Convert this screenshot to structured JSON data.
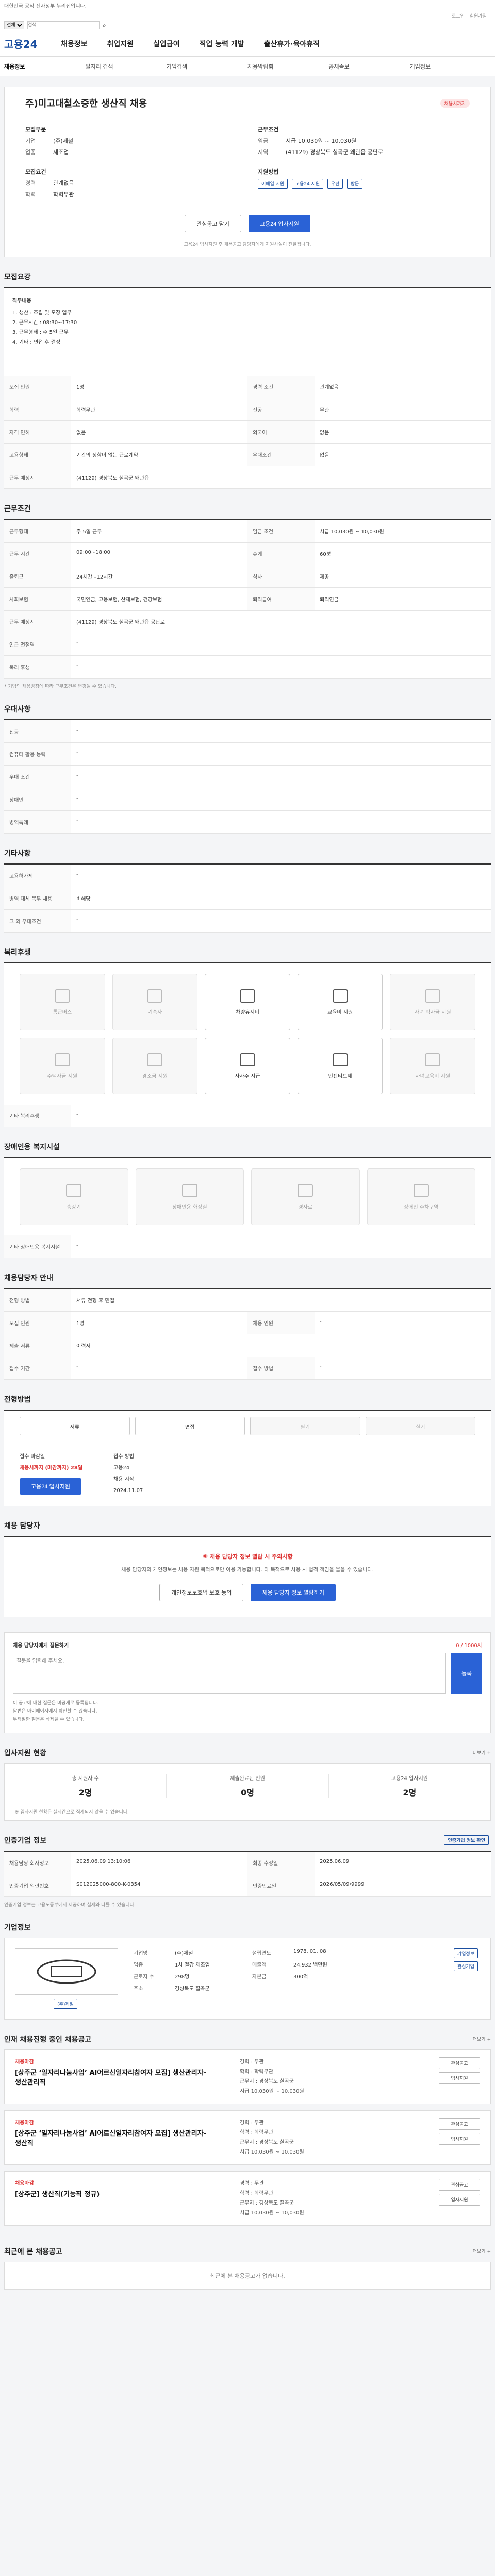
{
  "topbar": {
    "notice": "대한민국 공식 전자정부 누리집입니다."
  },
  "utility": {
    "links": [
      "로그인",
      "회원가입"
    ]
  },
  "search": {
    "select": "전체",
    "placeholder": "검색"
  },
  "header": {
    "logo": "고용24",
    "gnb": [
      "채용정보",
      "취업지원",
      "실업급여",
      "직업 능력 개발",
      "출산휴가·육아휴직"
    ]
  },
  "subnav": [
    "채용정보",
    "일자리 검색",
    "기업검색",
    "채용박람회",
    "공채속보",
    "기업정보"
  ],
  "job": {
    "title": "주)미고대철소중한 생산직 채용",
    "deadline_badge": "채용시까지",
    "company_label": "모집부문",
    "company_k1": "기업",
    "company_v1": "(주)제철",
    "company_k2": "업종",
    "company_v2": "제조업",
    "work_label": "모집요건",
    "work_k1": "경력",
    "work_v1": "관계없음",
    "work_k2": "학력",
    "work_v2": "학력무관",
    "loc_label": "근무조건",
    "loc_k1": "임금",
    "loc_v1": "시급 10,030원 ~ 10,030원",
    "loc_k2": "지역",
    "loc_v2": "(41129) 경상북도 칠곡군 왜관읍 공단로",
    "apply_label": "지원방법",
    "apply_tags": [
      "이메일 지원",
      "고용24 지원",
      "우편",
      "방문"
    ],
    "btn_interest": "관심공고 담기",
    "btn_apply": "고용24 입사지원",
    "btn_note": "고용24 입사지원 후 채용공고 담당자에게 지원사실이 전달됩니다."
  },
  "duty": {
    "header": "모집요강",
    "title": "직무내용",
    "lines": [
      "1. 생산 : 조립 및 포장 업무",
      "2. 근무시간 : 08:30~17:30",
      "3. 근무형태 : 주 5일 근무",
      "4. 기타 : 면접 후 결정"
    ]
  },
  "recruit_table": {
    "rows": [
      [
        "모집 인원",
        "1명",
        "경력 조건",
        "관계없음"
      ],
      [
        "학력",
        "학력무관",
        "전공",
        "무관"
      ],
      [
        "자격 면허",
        "없음",
        "외국어",
        "없음"
      ],
      [
        "고용형태",
        "기간의 정함이 없는 근로계약",
        "우대조건",
        "없음"
      ],
      [
        "근무 예정지",
        "(41129) 경상북도 칠곡군 왜관읍",
        "",
        ""
      ]
    ]
  },
  "cond": {
    "header": "근무조건",
    "rows": [
      [
        "근무형태",
        "주 5일 근무",
        "임금 조건",
        "시급 10,030원 ~ 10,030원"
      ],
      [
        "근무 시간",
        "09:00~18:00",
        "휴게",
        "60분"
      ],
      [
        "출퇴근",
        "24시간~12시간",
        "식사",
        "제공"
      ],
      [
        "사회보험",
        "국민연금, 고용보험, 산재보험, 건강보험",
        "퇴직급여",
        "퇴직연금"
      ],
      [
        "근무 예정지",
        "(41129) 경상북도 칠곡군 왜관읍 공단로",
        "",
        ""
      ],
      [
        "인근 전철역",
        "-",
        "",
        ""
      ],
      [
        "복리 후생",
        "-",
        "",
        ""
      ]
    ]
  },
  "cond_note": "* 기업의 채용방침에 따라 근무조건은 변경될 수 있습니다.",
  "pref": {
    "header": "우대사항",
    "rows": [
      [
        "전공",
        "-"
      ],
      [
        "컴퓨터 활용 능력",
        "-"
      ],
      [
        "우대 조건",
        "-"
      ],
      [
        "장애인",
        "-"
      ],
      [
        "병역특례",
        "-"
      ]
    ]
  },
  "etc": {
    "header": "기타사항",
    "rows": [
      [
        "고용허가제",
        "-"
      ],
      [
        "병역 대체 복무 채용",
        "비해당"
      ],
      [
        "그 외 우대조건",
        "-"
      ]
    ]
  },
  "welfare": {
    "header": "복리후생",
    "items": [
      "통근버스",
      "기숙사",
      "차량유지비",
      "교육비 지원",
      "자녀 학자금 지원",
      "주택자금 지원",
      "경조금 지원",
      "자사주 지급",
      "인센티브제",
      "자녀교육비 지원"
    ],
    "active": [
      2,
      3,
      7,
      8
    ],
    "note": "기타 복리후생"
  },
  "disabled": {
    "header": "장애인용 복지시설",
    "items": [
      "승강기",
      "장애인용 화장실",
      "경사로",
      "장애인 주차구역"
    ],
    "note": "기타 장애인용 복지시설"
  },
  "hr": {
    "header": "채용담당자 안내",
    "rows": [
      [
        "전형 방법",
        "서류 전형 후 면접",
        "",
        ""
      ],
      [
        "모집 인원",
        "1명",
        "채용 인원",
        "-"
      ],
      [
        "제출 서류",
        "이력서",
        "",
        ""
      ],
      [
        "접수 기간",
        "-",
        "접수 방법",
        "-"
      ]
    ]
  },
  "method": {
    "header": "전형방법",
    "tabs": [
      "서류",
      "면접",
      "필기",
      "실기"
    ]
  },
  "deadline": {
    "k1": "접수 마감일",
    "v1": "채용시까지 (마감까지) 28일",
    "k2": "접수 방법",
    "v2": "고용24",
    "k3": "채용 시작",
    "v3": "2024.11.07",
    "btn": "고용24 입사지원"
  },
  "contact": {
    "header": "채용 담당자",
    "notice": "※ 채용 담당자 정보 열람 시 주의사항",
    "desc": "채용 담당자의 개인정보는 채용 지원 목적으로만 이용 가능합니다. 타 목적으로 사용 시 법적 책임을 물을 수 있습니다.",
    "btn1": "개인정보보호법 보호 동의",
    "btn2": "채용 담당자 정보 열람하기"
  },
  "question": {
    "header": "채용 담당자에게 질문하기",
    "placeholder": "질문을 입력해 주세요.",
    "count": "0 / 1000자",
    "btn": "등록",
    "notes": [
      "이 공고에 대한 질문은 비공개로 등록됩니다.",
      "답변은 마이페이지에서 확인할 수 있습니다.",
      "부적절한 질문은 삭제될 수 있습니다."
    ]
  },
  "status": {
    "header": "입사지원 현황",
    "more": "더보기 +",
    "items": [
      {
        "k": "총 지원자 수",
        "v": "2명"
      },
      {
        "k": "제출완료된 인원",
        "v": "0명"
      },
      {
        "k": "고용24 입사지원",
        "v": "2명"
      }
    ],
    "note": "※ 입사지원 현황은 실시간으로 집계되지 않을 수 있습니다."
  },
  "manage": {
    "header": "인증기업 정보",
    "btn": "인증기업 정보 확인",
    "rows": [
      [
        "채용담당 회사정보",
        "2025.06.09 13:10:06",
        "최종 수정일",
        "2025.06.09"
      ],
      [
        "인증기업 일련번호",
        "S012025000-800-K-0354",
        "인증만료일",
        "2026/05/09/9999"
      ]
    ],
    "note": "인증기업 정보는 고용노동부에서 제공하며 실제와 다를 수 있습니다."
  },
  "company": {
    "header": "기업정보",
    "name": "(주)제철",
    "rows": [
      [
        "기업명",
        "(주)제철",
        "설립연도",
        "1978. 01. 08"
      ],
      [
        "업종",
        "1차 철강 제조업",
        "매출액",
        "24,932 백만원"
      ],
      [
        "근로자 수",
        "298명",
        "자본금",
        "300억"
      ],
      [
        "주소",
        "경상북도 칠곡군",
        "",
        ""
      ]
    ],
    "btns": [
      "기업정보",
      "관심기업"
    ]
  },
  "related": {
    "header": "인재 채용진행 중인 채용공고",
    "more": "더보기 +",
    "jobs": [
      {
        "tag": "채용마감",
        "title": "[상주군 ‘일자리나눔사업’ AI어르신일자리참여자 모집] 생산관리자-생산관리직",
        "info": [
          "경력 : 무관",
          "학력 : 학력무관",
          "근무지 : 경상북도 칠곡군",
          "시급 10,030원 ~ 10,030원"
        ]
      },
      {
        "tag": "채용마감",
        "title": "[상주군 ‘일자리나눔사업’ AI어르신일자리참여자 모집] 생산관리자-생산직",
        "info": [
          "경력 : 무관",
          "학력 : 학력무관",
          "근무지 : 경상북도 칠곡군",
          "시급 10,030원 ~ 10,030원"
        ]
      },
      {
        "tag": "채용마감",
        "title": "[상주군] 생산직(기능직 정규)",
        "info": [
          "경력 : 무관",
          "학력 : 학력무관",
          "근무지 : 경상북도 칠곡군",
          "시급 10,030원 ~ 10,030원"
        ]
      }
    ],
    "btns": [
      "관심공고",
      "입사지원"
    ]
  },
  "recent": {
    "header": "최근에 본 채용공고",
    "more": "더보기 +",
    "empty": "최근에 본 채용공고가 없습니다."
  }
}
